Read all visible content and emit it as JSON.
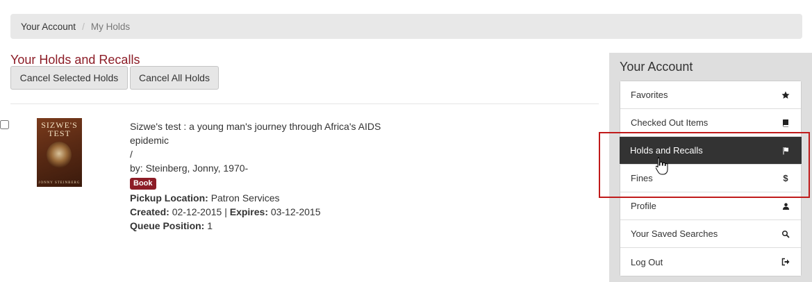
{
  "breadcrumb": {
    "home": "Your Account",
    "current": "My Holds"
  },
  "page": {
    "title": "Your Holds and Recalls",
    "cancel_selected_label": "Cancel Selected Holds",
    "cancel_all_label": "Cancel All Holds"
  },
  "holds": [
    {
      "cover_title": "SIZWE'S TEST",
      "cover_author": "JONNY STEINBERG",
      "title": "Sizwe's test : a young man's journey through Africa's AIDS epidemic",
      "slash": "/",
      "by": "by: Steinberg, Jonny, 1970-",
      "format": "Book",
      "pickup_label": "Pickup Location:",
      "pickup_value": "Patron Services",
      "created_label": "Created:",
      "created_value": "02-12-2015",
      "separator": "|",
      "expires_label": "Expires:",
      "expires_value": "03-12-2015",
      "queue_label": "Queue Position:",
      "queue_value": "1"
    }
  ],
  "sidebar": {
    "title": "Your Account",
    "items": [
      {
        "label": "Favorites",
        "icon": "star-icon"
      },
      {
        "label": "Checked Out Items",
        "icon": "book-icon"
      },
      {
        "label": "Holds and Recalls",
        "icon": "flag-icon",
        "active": true
      },
      {
        "label": "Fines",
        "icon": "dollar-icon",
        "glyph": "$"
      },
      {
        "label": "Profile",
        "icon": "user-icon"
      },
      {
        "label": "Your Saved Searches",
        "icon": "search-icon"
      },
      {
        "label": "Log Out",
        "icon": "sign-out-icon"
      }
    ]
  },
  "colors": {
    "accent": "#8c1c26",
    "active_menu_bg": "#333333",
    "highlight_box": "#c01a1a"
  }
}
